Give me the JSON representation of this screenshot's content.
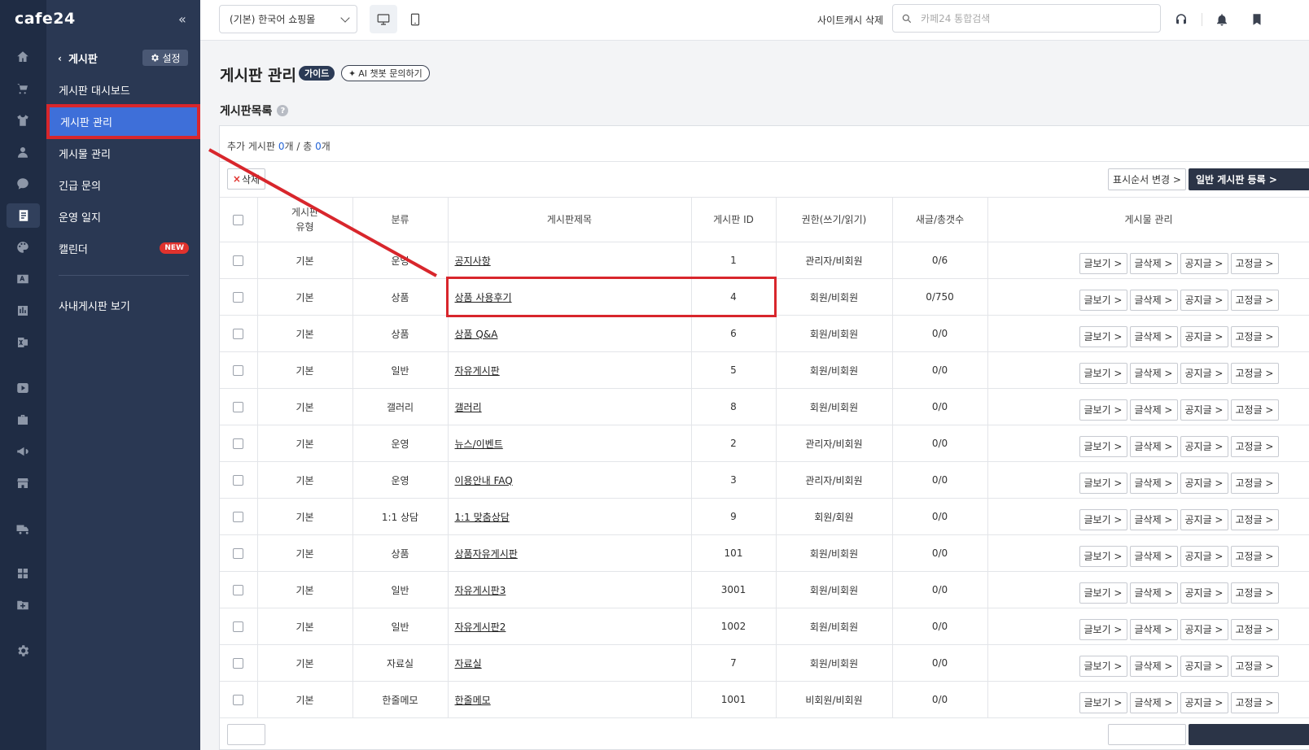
{
  "app": {
    "logo": "cafe24",
    "collapse_glyph": "«"
  },
  "rail": [
    {
      "name": "home-icon"
    },
    {
      "name": "cart-icon"
    },
    {
      "name": "shirt-icon"
    },
    {
      "name": "user-icon"
    },
    {
      "name": "chat-icon"
    },
    {
      "name": "board-icon",
      "active": true
    },
    {
      "name": "palette-icon"
    },
    {
      "name": "ad-icon"
    },
    {
      "name": "chart-icon"
    },
    {
      "name": "excel-icon"
    },
    {
      "name": "youtube-icon"
    },
    {
      "name": "briefcase-icon"
    },
    {
      "name": "megaphone-icon"
    },
    {
      "name": "store-icon"
    },
    {
      "name": "truck-icon"
    },
    {
      "name": "apps-icon"
    },
    {
      "name": "folder-icon"
    },
    {
      "name": "gear-icon"
    }
  ],
  "subnav": {
    "title": "게시판",
    "settings_label": "설정",
    "items": [
      {
        "label": "게시판 대시보드"
      },
      {
        "label": "게시판 관리",
        "active": true
      },
      {
        "label": "게시물 관리"
      },
      {
        "label": "긴급 문의"
      },
      {
        "label": "운영 일지"
      },
      {
        "label": "캘린더",
        "badge": "NEW"
      }
    ],
    "extra": "사내게시판 보기"
  },
  "topbar": {
    "shop_select": "(기본) 한국어 쇼핑몰",
    "cache_label": "사이트캐시 삭제",
    "search_placeholder": "카페24 통합검색"
  },
  "main": {
    "title": "게시판 관리",
    "guide_badge": "가이드",
    "ai_badge": "AI 챗봇 문의하기",
    "section_title": "게시판목록",
    "help_glyph": "?",
    "count": {
      "prefix": "추가 게시판 ",
      "added": "0",
      "mid": "개 / 총 ",
      "total": "0",
      "suffix": "개"
    },
    "delete_label": "삭제",
    "order_label": "표시순서 변경 >",
    "register_label": "일반 게시판 등록 >"
  },
  "table": {
    "headers": [
      "",
      "게시판 유형",
      "분류",
      "게시판제목",
      "게시판 ID",
      "권한(쓰기/읽기)",
      "새글/총갯수",
      "게시물 관리"
    ],
    "action_labels": [
      "글보기 >",
      "글삭제 >",
      "공지글 >",
      "고정글 >"
    ],
    "rows": [
      {
        "type": "기본",
        "category": "운영",
        "title": "공지사항",
        "id": "1",
        "perm": "관리자/비회원",
        "count": "0/6"
      },
      {
        "type": "기본",
        "category": "상품",
        "title": "상품 사용후기",
        "id": "4",
        "perm": "회원/비회원",
        "count": "0/750"
      },
      {
        "type": "기본",
        "category": "상품",
        "title": "상품 Q&A",
        "id": "6",
        "perm": "회원/비회원",
        "count": "0/0"
      },
      {
        "type": "기본",
        "category": "일반",
        "title": "자유게시판",
        "id": "5",
        "perm": "회원/비회원",
        "count": "0/0"
      },
      {
        "type": "기본",
        "category": "갤러리",
        "title": "갤러리",
        "id": "8",
        "perm": "회원/비회원",
        "count": "0/0"
      },
      {
        "type": "기본",
        "category": "운영",
        "title": "뉴스/이벤트",
        "id": "2",
        "perm": "관리자/비회원",
        "count": "0/0"
      },
      {
        "type": "기본",
        "category": "운영",
        "title": "이용안내 FAQ",
        "id": "3",
        "perm": "관리자/비회원",
        "count": "0/0"
      },
      {
        "type": "기본",
        "category": "1:1 상담",
        "title": "1:1 맞춤상담",
        "id": "9",
        "perm": "회원/회원",
        "count": "0/0"
      },
      {
        "type": "기본",
        "category": "상품",
        "title": "상품자유게시판",
        "id": "101",
        "perm": "회원/비회원",
        "count": "0/0"
      },
      {
        "type": "기본",
        "category": "일반",
        "title": "자유게시판3",
        "id": "3001",
        "perm": "회원/비회원",
        "count": "0/0"
      },
      {
        "type": "기본",
        "category": "일반",
        "title": "자유게시판2",
        "id": "1002",
        "perm": "회원/비회원",
        "count": "0/0"
      },
      {
        "type": "기본",
        "category": "자료실",
        "title": "자료실",
        "id": "7",
        "perm": "회원/비회원",
        "count": "0/0"
      },
      {
        "type": "기본",
        "category": "한줄메모",
        "title": "한줄메모",
        "id": "1001",
        "perm": "비회원/비회원",
        "count": "0/0"
      }
    ]
  },
  "colors": {
    "accent": "#3e6fd9",
    "annotation": "#d8262c",
    "sidebar": "#2a3853",
    "rail": "#1f2c44"
  }
}
